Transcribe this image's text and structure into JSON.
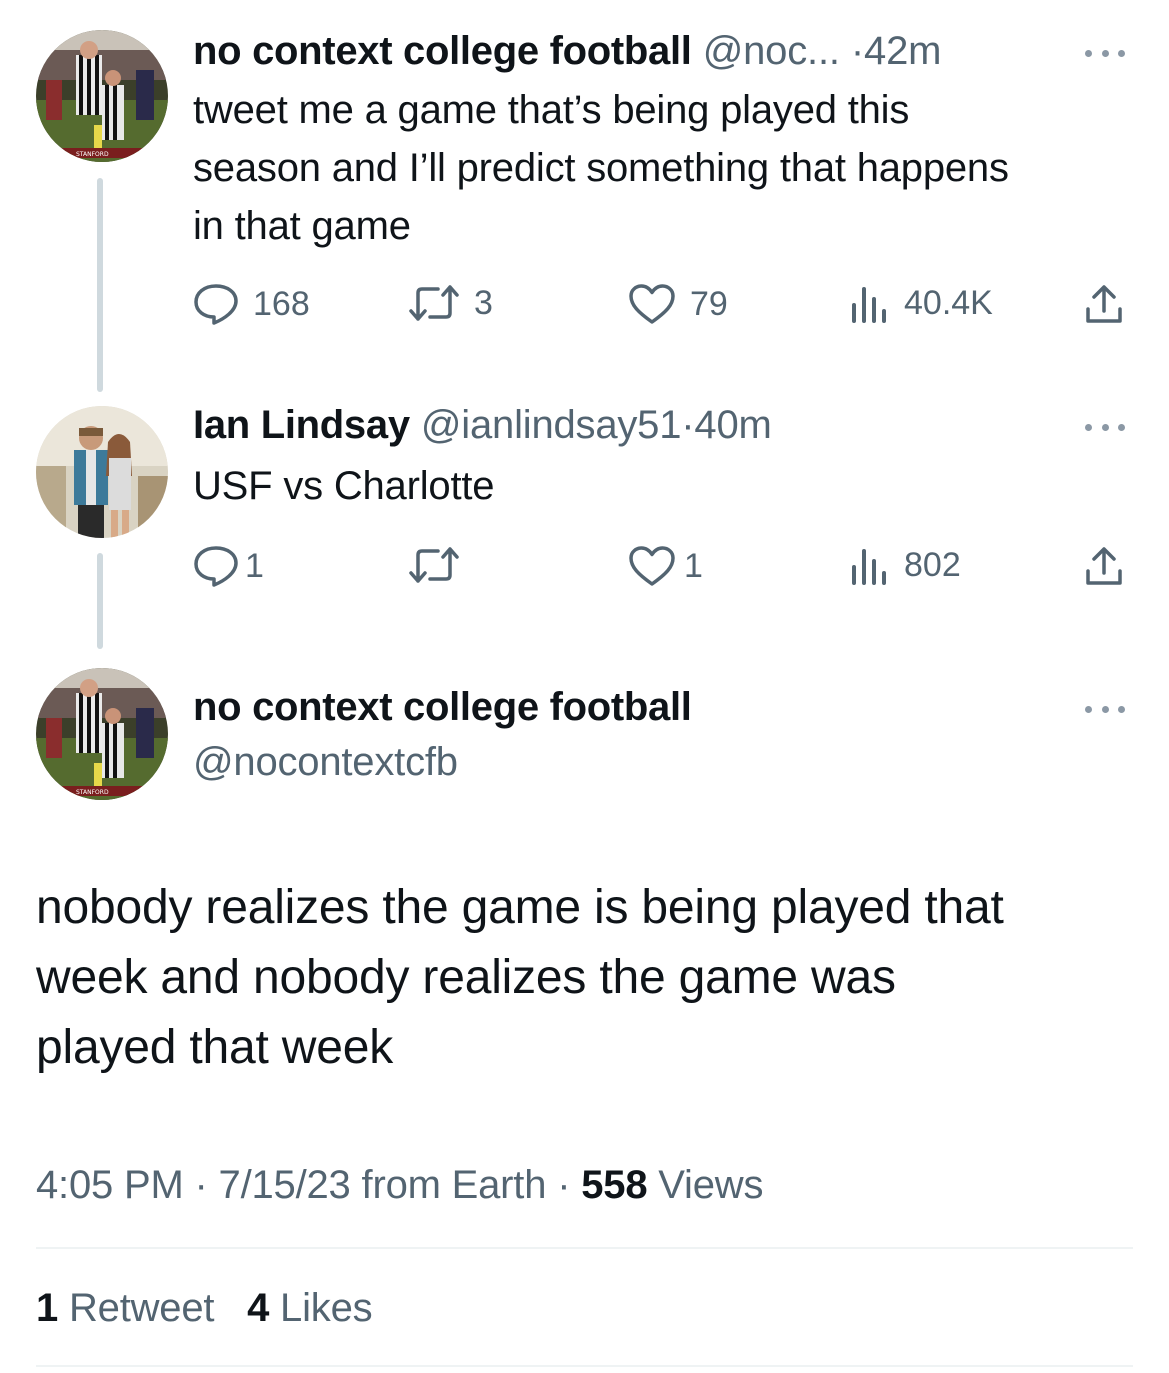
{
  "thread": [
    {
      "author_name": "no context college football",
      "handle": "@noc...",
      "separator": "·",
      "time": "42m",
      "text_lines": [
        "tweet me a game that’s being played this",
        "season and I’ll predict something that happens",
        "in that game"
      ],
      "replies": "168",
      "retweets": "3",
      "likes": "79",
      "views": "40.4K"
    },
    {
      "author_name": "Ian Lindsay",
      "handle": "@ianlindsay51",
      "separator": "·",
      "time": "40m",
      "text_lines": [
        "USF vs Charlotte"
      ],
      "replies": "1",
      "retweets": "",
      "likes": "1",
      "views": "802"
    }
  ],
  "main": {
    "author_name": "no context college football",
    "handle": "@nocontextcfb",
    "text_lines": [
      "nobody realizes the game is being played that",
      "week and nobody realizes the game was",
      "played that week"
    ],
    "time": "4:05 PM",
    "date": "7/15/23",
    "source": "from Earth",
    "views_count": "558",
    "views_label": "Views",
    "separator": "·",
    "retweet_count": "1",
    "retweet_label": "Retweet",
    "like_count": "4",
    "like_label": "Likes"
  },
  "avatar_badge_text": "STANFORD",
  "colors": {
    "text": "#0f1419",
    "secondary": "#536471",
    "thread_line": "#cfd9de",
    "divider": "#eff3f4",
    "more_dots": "#8b98a5"
  },
  "icons": [
    "reply-icon",
    "retweet-icon",
    "like-icon",
    "views-icon",
    "share-icon",
    "more-icon"
  ]
}
